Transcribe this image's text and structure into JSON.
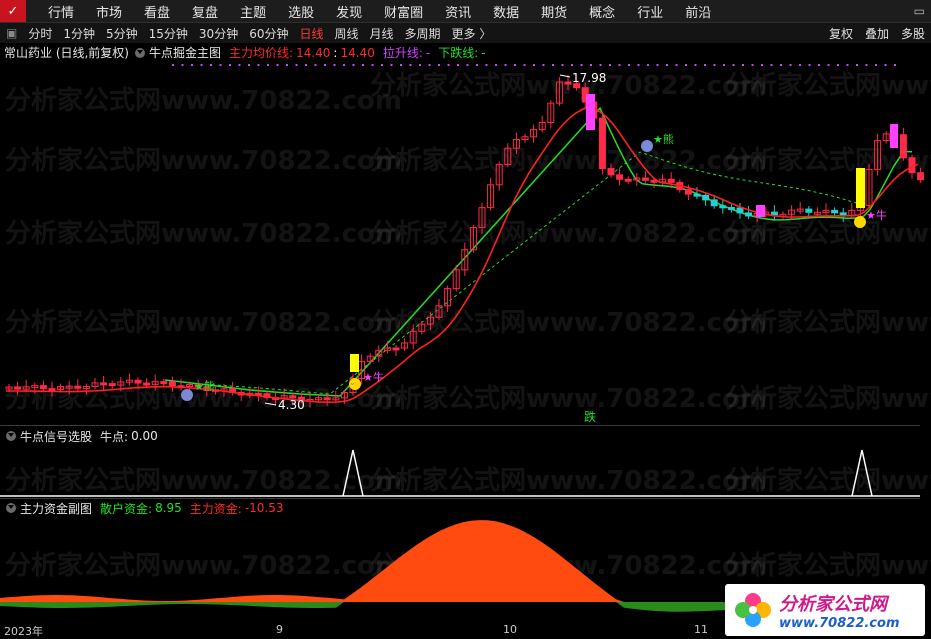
{
  "nav": [
    "行情",
    "市场",
    "看盘",
    "复盘",
    "主题",
    "选股",
    "发现",
    "财富圈",
    "资讯",
    "数据",
    "期货",
    "概念",
    "行业",
    "前沿"
  ],
  "periods": [
    "分时",
    "1分钟",
    "5分钟",
    "15分钟",
    "30分钟",
    "60分钟",
    "日线",
    "周线",
    "月线",
    "多周期",
    "更多 〉"
  ],
  "active_period": "日线",
  "tools": [
    "复权",
    "叠加",
    "多股"
  ],
  "main": {
    "stock": "常山药业 (日线,前复权)",
    "indicator": "牛点掘金主图",
    "avg_label": "主力均价线:",
    "avg_value": "14.40",
    "lift_label": "拉升线:",
    "lift_value": "14.40",
    "down_label": "下跌线:",
    "down_value": "-",
    "high_label": "17.98",
    "low_label": "4.30",
    "bull": "★牛",
    "bear": "★熊",
    "die": "跌"
  },
  "sub1": {
    "title": "牛点信号选股",
    "label": "牛点:",
    "value": "0.00"
  },
  "sub2": {
    "title": "主力资金副图",
    "retail_label": "散户资金:",
    "retail_value": "8.95",
    "main_label": "主力资金:",
    "main_value": "-10.53"
  },
  "xaxis": [
    "2023年",
    "9",
    "10",
    "11"
  ],
  "watermark": "分析家公式网www.70822.com",
  "brand": {
    "name": "分析家公式网",
    "url": "www.70822.com"
  },
  "colors": {
    "up": "#ff2a4a",
    "down": "#22d0d0",
    "avg": "#ff2020",
    "lift": "#22e022",
    "retail": "#2a9a20",
    "mainfund": "#ff4a10"
  }
}
